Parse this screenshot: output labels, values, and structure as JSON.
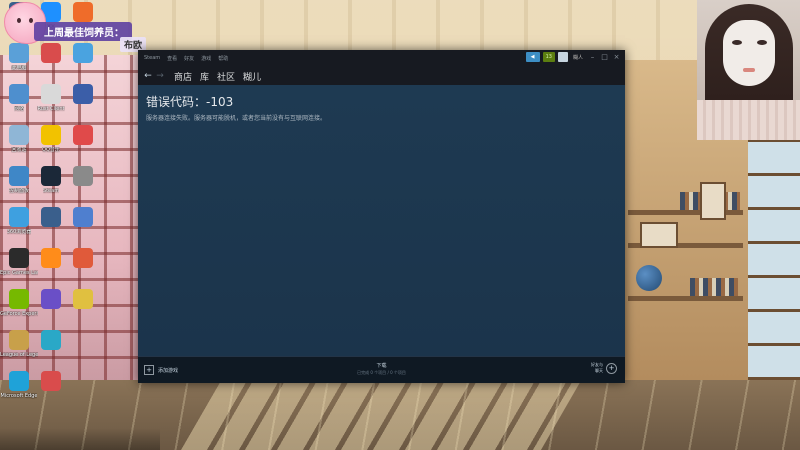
{
  "overlay": {
    "fan_title": "上周最佳饲养员：",
    "fan_name": "布欧"
  },
  "steam": {
    "title_menu": [
      "Steam",
      "查看",
      "好友",
      "游戏",
      "帮助"
    ],
    "points": "13",
    "username": "糊人",
    "nav_back": "←",
    "nav_forward": "→",
    "nav_links": [
      "商店",
      "库",
      "社区",
      "糊儿"
    ],
    "error_code": "错误代码：-103",
    "error_message": "服务器连接失败。服务器可能脱机，或者您当前没有与互联网连接。",
    "footer_add_game": "添加游戏",
    "footer_downloads": "下载",
    "footer_downloads_sub": "已完成 0 个项目 / 0 个项目",
    "footer_friends_line1": "好友与",
    "footer_friends_line2": "聊天"
  },
  "desktop": {
    "icons": [
      {
        "label": "",
        "color": "#3a5f8c"
      },
      {
        "label": "此电脑",
        "color": "#5aa0d8"
      },
      {
        "label": "网络",
        "color": "#4e8fce"
      },
      {
        "label": "回收站",
        "color": "#8fb6d6"
      },
      {
        "label": "控制面板",
        "color": "#3f87c7"
      },
      {
        "label": "360浏览器",
        "color": "#3ea0e0"
      },
      {
        "label": "Epic Games Launcher",
        "color": "#2b2b2b"
      },
      {
        "label": "GeForce Experience",
        "color": "#76b900"
      },
      {
        "label": "League of Legends",
        "color": "#c8a04a"
      },
      {
        "label": "Microsoft Edge",
        "color": "#1fa2d8"
      },
      {
        "label": "QQ",
        "color": "#1e90ff"
      },
      {
        "label": "",
        "color": "#d94c4c"
      },
      {
        "label": "Rust Client",
        "color": "#d9d9d9"
      },
      {
        "label": "QQ音乐",
        "color": "#f2c200"
      },
      {
        "label": "Steam",
        "color": "#1b2838"
      },
      {
        "label": "",
        "color": "#3a5f8c"
      },
      {
        "label": "",
        "color": "#ff8c1a"
      },
      {
        "label": "",
        "color": "#6a4fc7"
      },
      {
        "label": "",
        "color": "#2aa8c7"
      },
      {
        "label": "",
        "color": "#d94c4c"
      },
      {
        "label": "",
        "color": "#ef6c2a"
      },
      {
        "label": "",
        "color": "#4aa3e0"
      },
      {
        "label": "",
        "color": "#3b5ea8"
      },
      {
        "label": "",
        "color": "#e04a4a"
      },
      {
        "label": "",
        "color": "#8a8a8a"
      },
      {
        "label": "",
        "color": "#4f7fcf"
      },
      {
        "label": "",
        "color": "#e05a3a"
      },
      {
        "label": "",
        "color": "#e0c040"
      }
    ]
  }
}
